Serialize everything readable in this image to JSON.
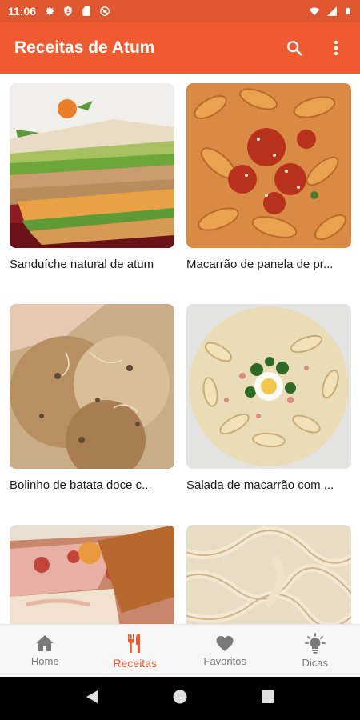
{
  "status_bar": {
    "time": "11:06"
  },
  "app_bar": {
    "title": "Receitas de Atum"
  },
  "recipes": [
    {
      "title": "Sanduíche natural de atum"
    },
    {
      "title": "Macarrão de panela de pr..."
    },
    {
      "title": "Bolinho de batata doce c..."
    },
    {
      "title": "Salada de macarrão com ..."
    },
    {
      "title": ""
    },
    {
      "title": ""
    }
  ],
  "bottom_nav": {
    "items": [
      {
        "label": "Home",
        "icon": "home-icon"
      },
      {
        "label": "Receitas",
        "icon": "cutlery-icon"
      },
      {
        "label": "Favoritos",
        "icon": "heart-icon"
      },
      {
        "label": "Dicas",
        "icon": "lightbulb-icon"
      }
    ],
    "active": "Receitas"
  },
  "colors": {
    "accent": "#ef5a31",
    "status_bar": "#e0562f",
    "text": "#1d1d1d",
    "nav_inactive": "#7a7a7a"
  }
}
